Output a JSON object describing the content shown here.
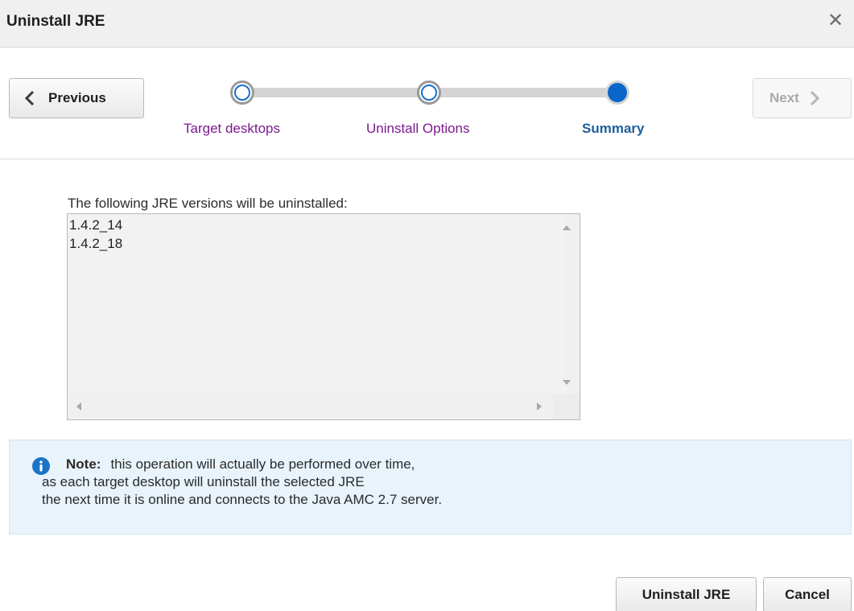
{
  "dialog": {
    "title": "Uninstall JRE",
    "close_icon": "close-icon"
  },
  "train": {
    "previous_label": "Previous",
    "next_label": "Next",
    "next_enabled": false,
    "stops": [
      {
        "label": "Target desktops",
        "state": "visited"
      },
      {
        "label": "Uninstall Options",
        "state": "visited"
      },
      {
        "label": "Summary",
        "state": "current"
      }
    ]
  },
  "summary": {
    "caption": "The following JRE versions will be uninstalled:",
    "versions": [
      "1.4.2_14",
      "1.4.2_18"
    ]
  },
  "note": {
    "icon": "info-icon",
    "label": "Note:",
    "line1": "this operation will actually be performed over time,",
    "line2": "as each target desktop will uninstall the selected JRE",
    "line3": "the next time it is online and connects to the Java AMC 2.7 server."
  },
  "actions": {
    "uninstall_label": "Uninstall JRE",
    "cancel_label": "Cancel"
  },
  "colors": {
    "accent": "#0a67c9",
    "visited_link": "#7a1b8e",
    "current_label": "#1f5d9a",
    "note_background": "#e8f3fb",
    "info_icon": "#1a73c7"
  }
}
